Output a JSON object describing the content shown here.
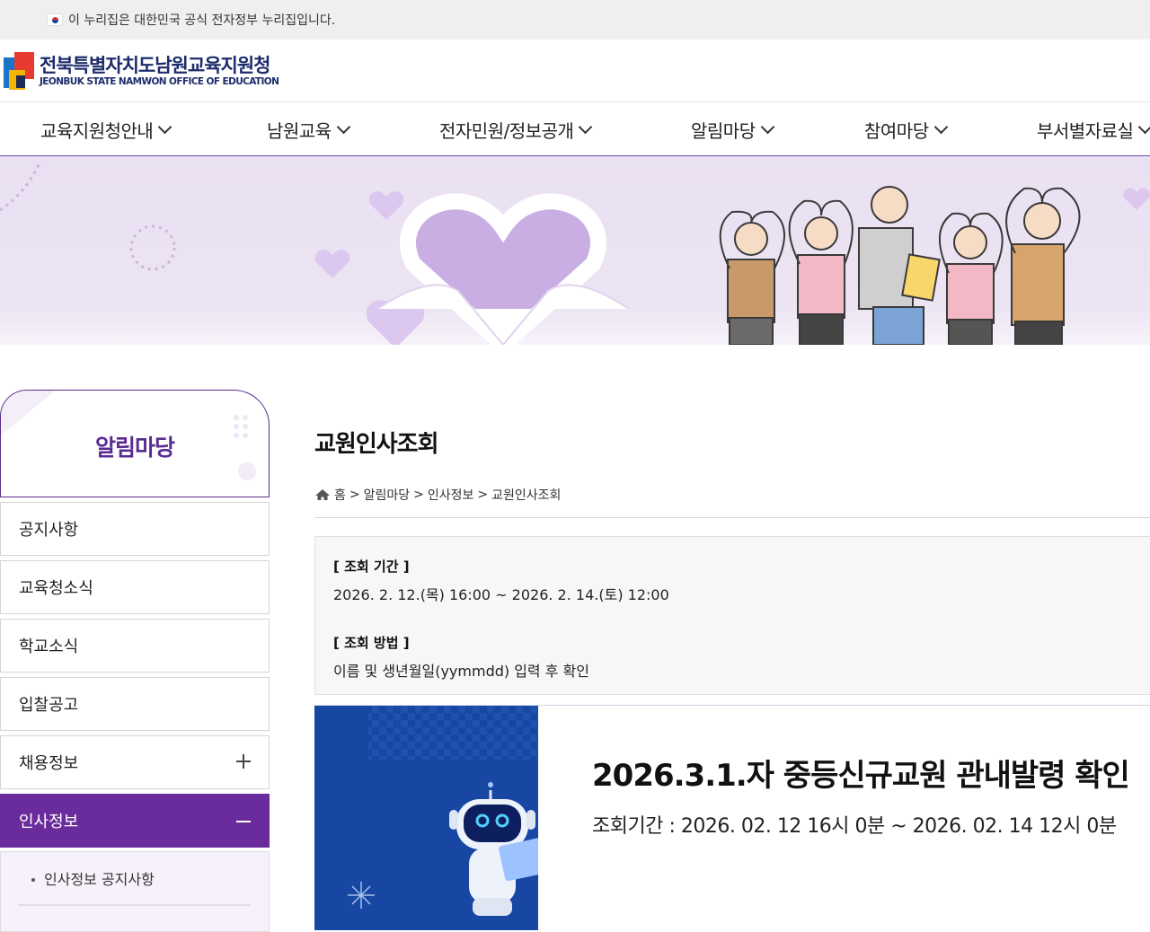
{
  "gov_bar": {
    "text": "이 누리집은 대한민국 공식 전자정부 누리집입니다."
  },
  "header": {
    "logo_ko": "전북특별자치도남원교육지원청",
    "logo_en": "JEONBUK STATE NAMWON OFFICE OF EDUCATION"
  },
  "gnb": [
    {
      "label": "교육지원청안내"
    },
    {
      "label": "남원교육"
    },
    {
      "label": "전자민원/정보공개"
    },
    {
      "label": "알림마당"
    },
    {
      "label": "참여마당"
    },
    {
      "label": "부서별자료실"
    }
  ],
  "sidebar": {
    "title": "알림마당",
    "items": [
      {
        "label": "공지사항"
      },
      {
        "label": "교육청소식"
      },
      {
        "label": "학교소식"
      },
      {
        "label": "입찰공고"
      },
      {
        "label": "채용정보"
      },
      {
        "label": "인사정보"
      }
    ],
    "sub_items": [
      {
        "label": "인사정보 공지사항"
      }
    ]
  },
  "content": {
    "title": "교원인사조회",
    "breadcrumb": [
      "홈",
      "알림마당",
      "인사정보",
      "교원인사조회"
    ],
    "breadcrumb_sep": ">",
    "period_heading": "[ 조회 기간 ]",
    "period_value": "2026. 2. 12.(목) 16:00 ~ 2026. 2. 14.(토) 12:00",
    "method_heading": "[ 조회 방법 ]",
    "method_value": "이름 및 생년월일(yymmdd) 입력 후 확인",
    "promo_headline": "2026.3.1.자 중등신규교원 관내발령 확인",
    "promo_period": "조회기간 : 2026. 02. 12 16시 0분 ~ 2026. 02. 14 12시 0분"
  },
  "colors": {
    "accent_purple": "#6a2c9c",
    "sidebar_title": "#5a2b91",
    "banner_bg": "#e9e0f1",
    "promo_blue": "#1747a2"
  }
}
